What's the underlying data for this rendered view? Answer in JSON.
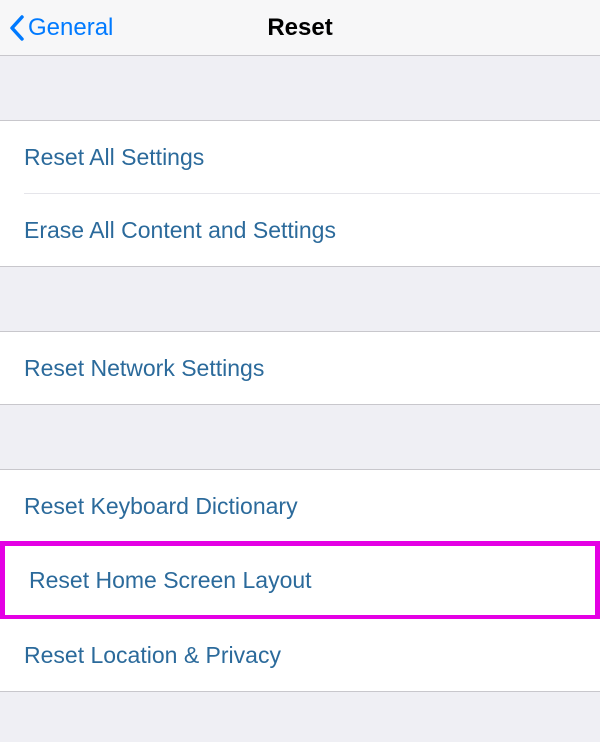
{
  "nav": {
    "back_label": "General",
    "title": "Reset"
  },
  "groups": [
    {
      "items": [
        {
          "label": "Reset All Settings"
        },
        {
          "label": "Erase All Content and Settings"
        }
      ]
    },
    {
      "items": [
        {
          "label": "Reset Network Settings"
        }
      ]
    },
    {
      "items": [
        {
          "label": "Reset Keyboard Dictionary"
        },
        {
          "label": "Reset Home Screen Layout",
          "highlighted": true
        },
        {
          "label": "Reset Location & Privacy"
        }
      ]
    }
  ]
}
